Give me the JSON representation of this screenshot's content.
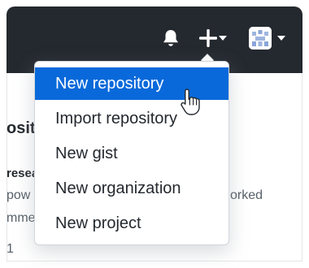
{
  "menu": {
    "items": [
      {
        "label": "New repository"
      },
      {
        "label": "Import repository"
      },
      {
        "label": "New gist"
      },
      {
        "label": "New organization"
      },
      {
        "label": "New project"
      }
    ],
    "active_index": 0
  },
  "background": {
    "partial_heading": "osit",
    "partial_owner": "resea",
    "partial_desc_left": "pow",
    "partial_desc_right": "orked",
    "partial_line3": "mme",
    "partial_count": "1"
  },
  "colors": {
    "header_bg": "#24292f",
    "accent": "#0969da"
  },
  "icons": {
    "notifications": "bell-icon",
    "create": "plus-icon",
    "profile": "avatar"
  }
}
